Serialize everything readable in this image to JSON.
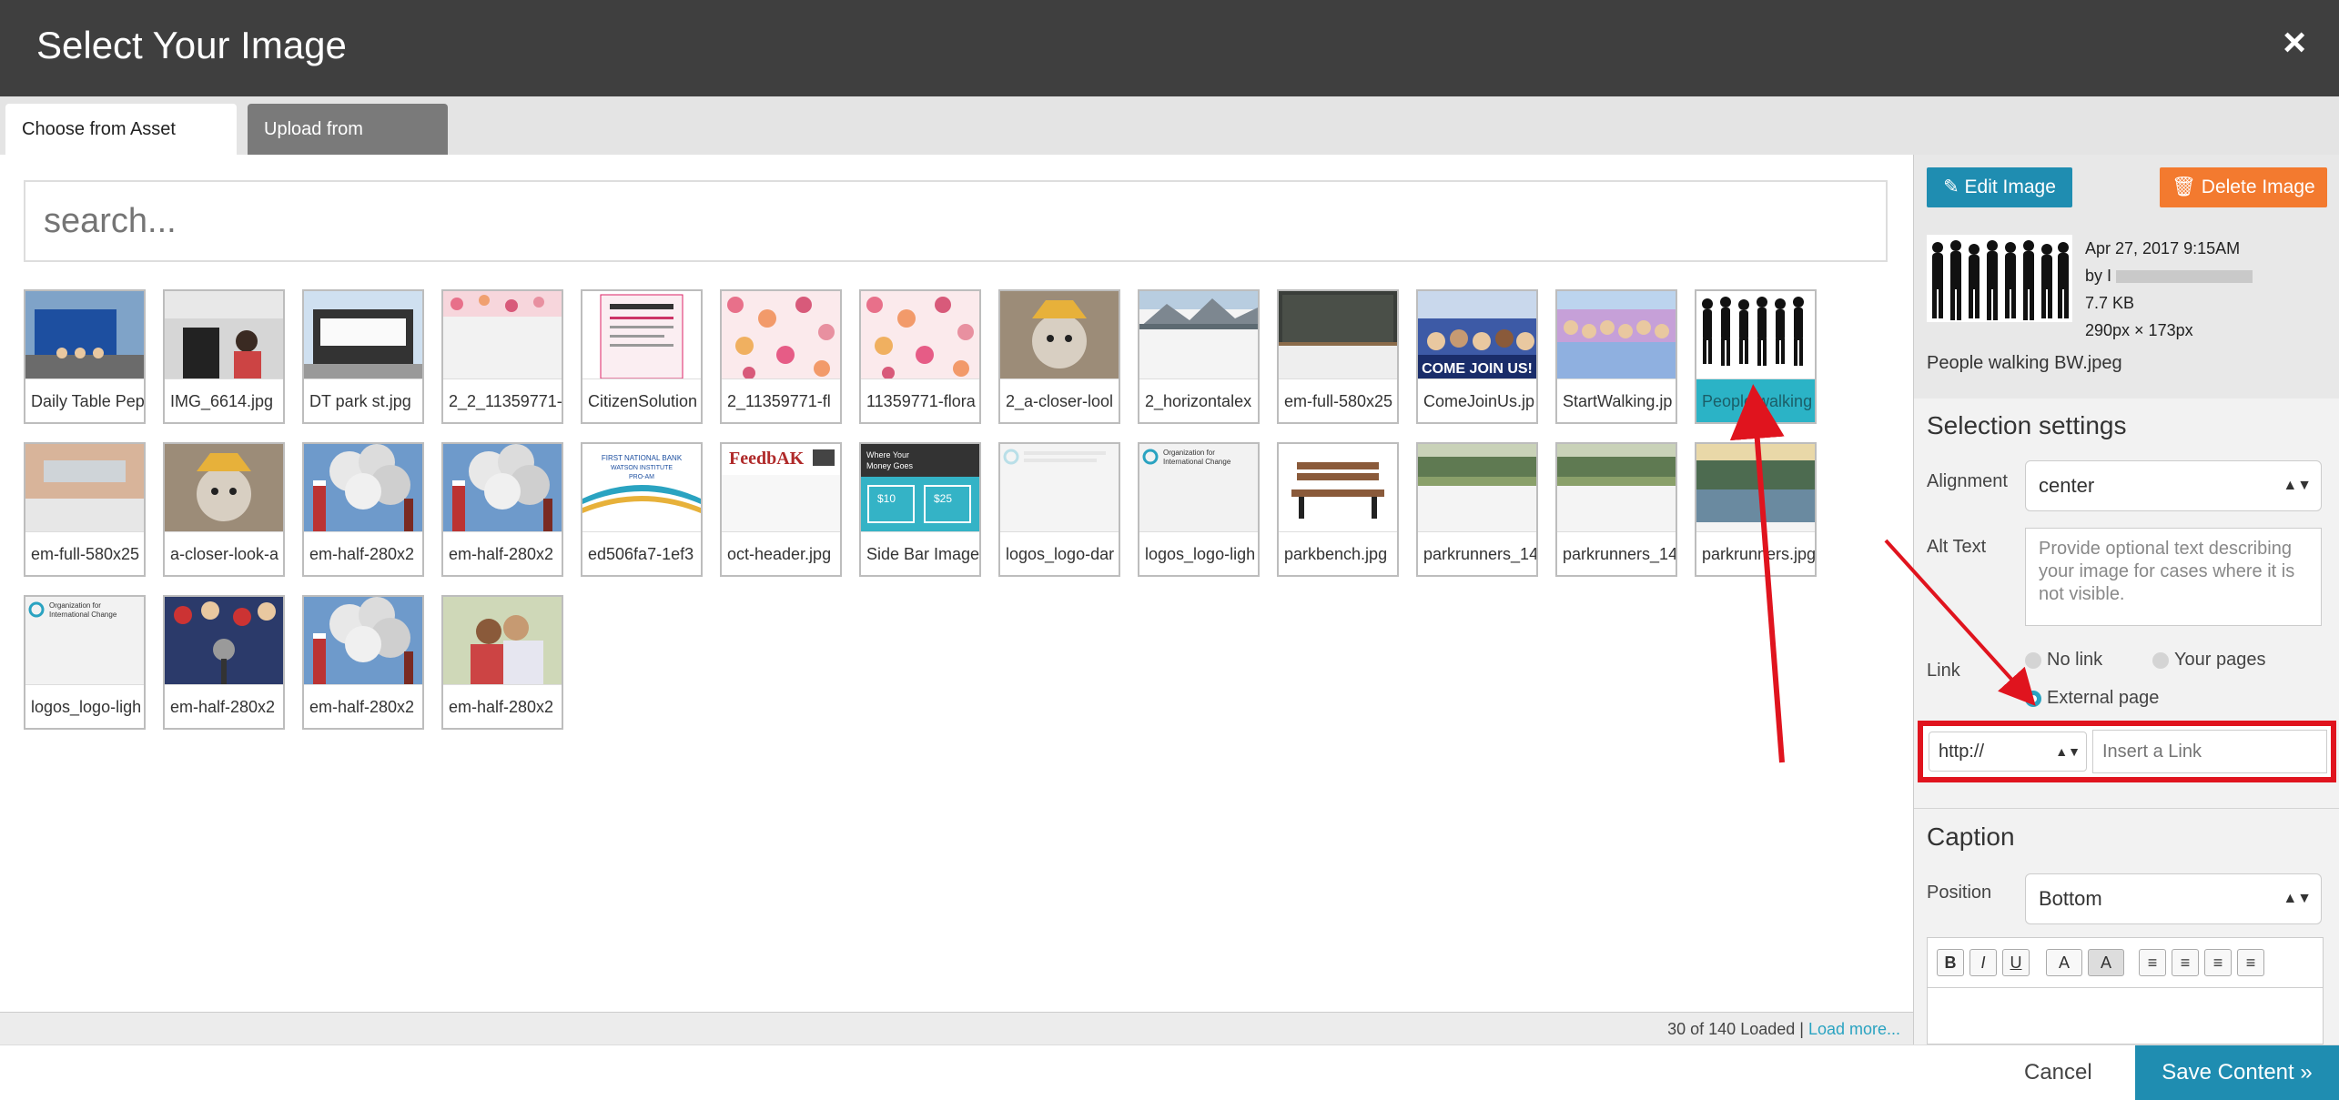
{
  "dialog": {
    "title": "Select Your Image",
    "close_glyph": "×"
  },
  "tabs": [
    {
      "label": "Choose from Asset Library",
      "active": true
    },
    {
      "label": "Upload from Computer",
      "active": false
    }
  ],
  "search": {
    "placeholder": "search..."
  },
  "assets": [
    {
      "caption": "Daily Table Pep",
      "kind": "photo-street",
      "selected": false
    },
    {
      "caption": "IMG_6614.jpg",
      "kind": "photo-kitchen",
      "selected": false
    },
    {
      "caption": "DT park st.jpg",
      "kind": "photo-building",
      "selected": false
    },
    {
      "caption": "2_2_11359771-",
      "kind": "floral-strip",
      "selected": false
    },
    {
      "caption": "CitizenSolution",
      "kind": "document",
      "selected": false
    },
    {
      "caption": "2_11359771-fl",
      "kind": "floral",
      "selected": false
    },
    {
      "caption": "11359771-flora",
      "kind": "floral",
      "selected": false
    },
    {
      "caption": "2_a-closer-lool",
      "kind": "dog",
      "selected": false
    },
    {
      "caption": "2_horizontalex",
      "kind": "mountains",
      "selected": false
    },
    {
      "caption": "em-full-580x25",
      "kind": "blackboard",
      "selected": false
    },
    {
      "caption": "ComeJoinUs.jp",
      "kind": "crowd-banner",
      "selected": false
    },
    {
      "caption": "StartWalking.jp",
      "kind": "crowd",
      "selected": false
    },
    {
      "caption": "People walking",
      "kind": "silhouettes",
      "selected": true
    },
    {
      "caption": "em-full-580x25",
      "kind": "mouth-tape",
      "selected": false
    },
    {
      "caption": "a-closer-look-a",
      "kind": "dog",
      "selected": false
    },
    {
      "caption": "em-half-280x2",
      "kind": "smokestack",
      "selected": false
    },
    {
      "caption": "em-half-280x2",
      "kind": "smokestack",
      "selected": false
    },
    {
      "caption": "ed506fa7-1ef3",
      "kind": "logo-bank",
      "selected": false
    },
    {
      "caption": "oct-header.jpg",
      "kind": "feedback",
      "selected": false
    },
    {
      "caption": "Side Bar Image",
      "kind": "money",
      "selected": false
    },
    {
      "caption": "logos_logo-dar",
      "kind": "logo-faint",
      "selected": false
    },
    {
      "caption": "logos_logo-ligh",
      "kind": "logo-org",
      "selected": false
    },
    {
      "caption": "parkbench.jpg",
      "kind": "bench",
      "selected": false
    },
    {
      "caption": "parkrunners_14",
      "kind": "park",
      "selected": false
    },
    {
      "caption": "parkrunners_14",
      "kind": "park",
      "selected": false
    },
    {
      "caption": "parkrunners.jpg",
      "kind": "park-water",
      "selected": false
    },
    {
      "caption": "logos_logo-ligh",
      "kind": "logo-org",
      "selected": false
    },
    {
      "caption": "em-half-280x2",
      "kind": "microphone",
      "selected": false
    },
    {
      "caption": "em-half-280x2",
      "kind": "smokestack",
      "selected": false
    },
    {
      "caption": "em-half-280x2",
      "kind": "couple",
      "selected": false
    }
  ],
  "asset_logo_text": {
    "org": "Organization for International Change",
    "bank": "FIRST NATIONAL BANK WATSON INSTITUTE PRO-AM",
    "feedback": "FeedbAK",
    "money_title": "Where Your Money Goes",
    "money_a": "$10",
    "money_b": "$25",
    "banner": "COME JOIN US!"
  },
  "loaded_status": {
    "count_text": "30 of 140 Loaded | ",
    "load_more": "Load more..."
  },
  "details": {
    "edit_label": "Edit Image",
    "delete_label": "Delete Image",
    "date": "Apr 27, 2017 9:15AM",
    "by_prefix": "by I",
    "size": "7.7 KB",
    "dimensions": "290px × 173px",
    "filename": "People walking BW.jpeg"
  },
  "selection_settings": {
    "title": "Selection settings",
    "alignment_label": "Alignment",
    "alignment_value": "center",
    "alt_label": "Alt Text",
    "alt_placeholder": "Provide optional text describing your image for cases where it is not visible.",
    "link_label": "Link",
    "link_options": [
      {
        "label": "No link",
        "checked": false
      },
      {
        "label": "Your pages",
        "checked": false
      },
      {
        "label": "External page",
        "checked": true
      }
    ],
    "protocol_value": "http://",
    "link_placeholder": "Insert a Link"
  },
  "caption": {
    "title": "Caption",
    "position_label": "Position",
    "position_value": "Bottom",
    "toolbar": [
      "B",
      "I",
      "U",
      "A",
      "A",
      "≡",
      "≡",
      "≡",
      "≡"
    ]
  },
  "actions": {
    "cancel_label": "Cancel",
    "save_label": "Save Content »"
  },
  "colors": {
    "header_bg": "#3f3f3f",
    "accent_teal": "#1f8db1",
    "accent_orange": "#f37a2f",
    "selected_caption": "#2bb3c6",
    "highlight_red": "#e0141e"
  }
}
